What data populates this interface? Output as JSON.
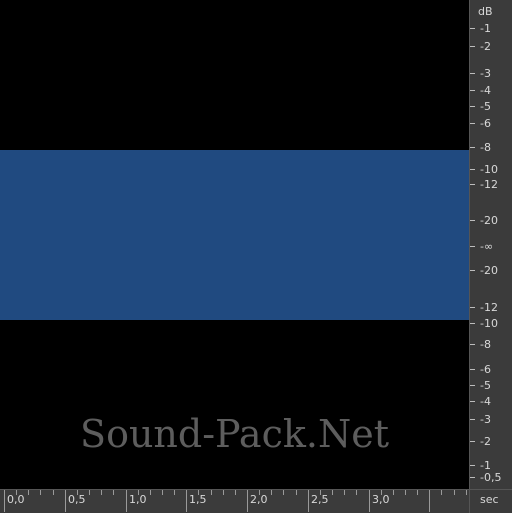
{
  "colors": {
    "wave_top": "#2e7dd8",
    "wave_bottom": "#6aa8ff",
    "background": "#000000",
    "ruler": "#3b3b3b",
    "label": "#d8d8d8"
  },
  "watermark": "Sound-Pack.Net",
  "db_ruler": {
    "unit": "dB",
    "labels": [
      "-1",
      "-2",
      "-3",
      "-4",
      "-5",
      "-6",
      "-8",
      "-10",
      "-12",
      "-20",
      "-∞",
      "-20",
      "-12",
      "-10",
      "-8",
      "-6",
      "-5",
      "-4",
      "-3",
      "-2",
      "-1",
      "-0,5"
    ]
  },
  "time_ruler": {
    "unit": "sec",
    "labels": [
      "0,0",
      "0,5",
      "1,0",
      "1,5",
      "2,0",
      "2,5",
      "3,0"
    ]
  },
  "waveform": {
    "duration_sec": 3.7,
    "display_range_sec": [
      0,
      3.8
    ]
  }
}
